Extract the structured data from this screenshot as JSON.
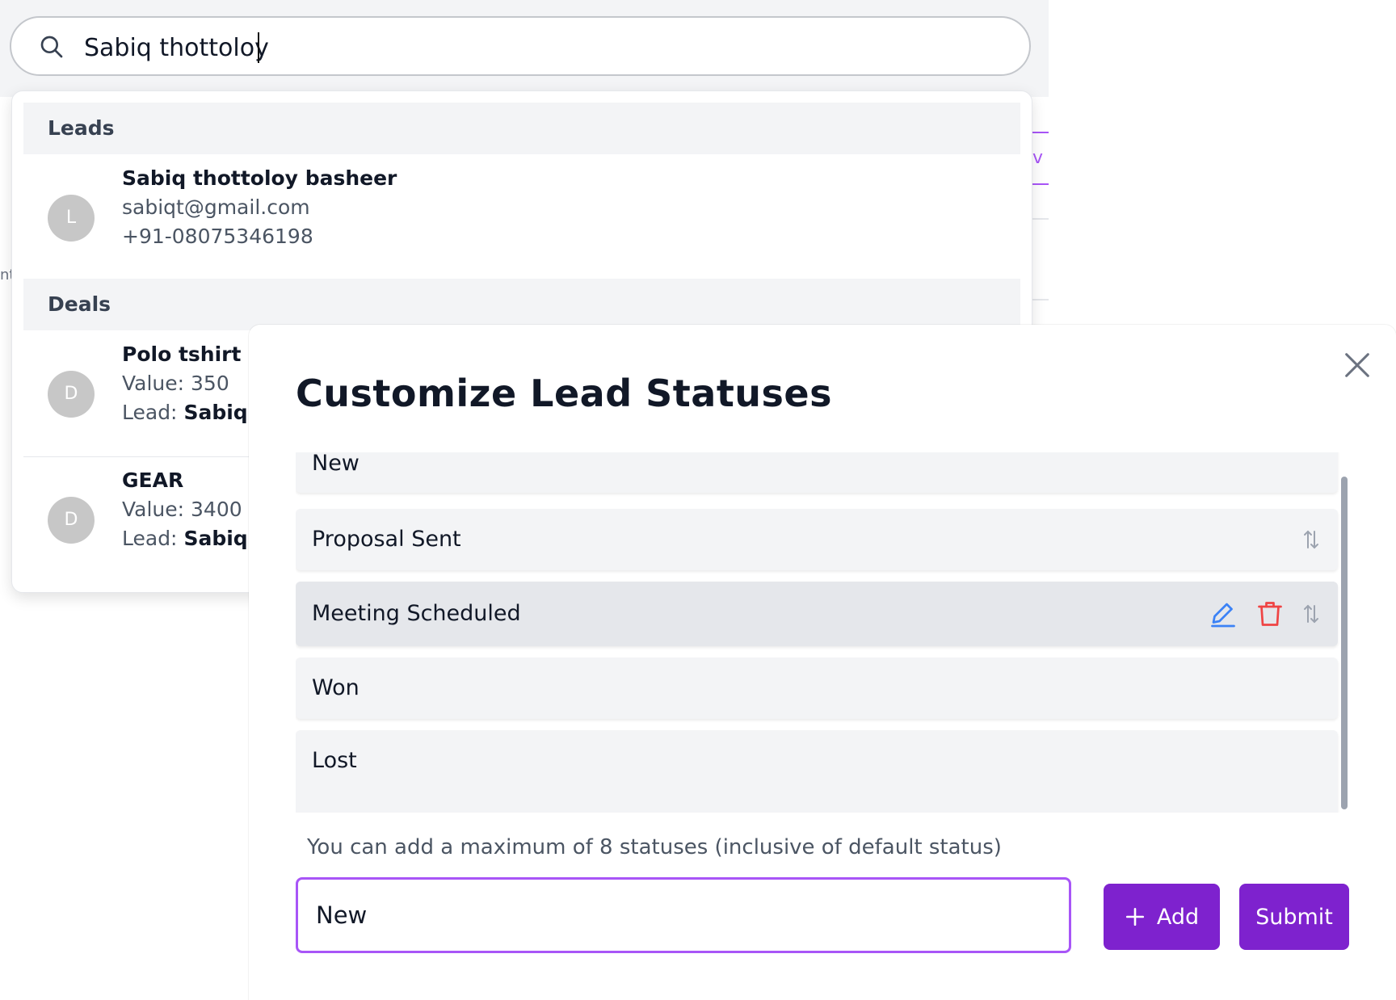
{
  "search": {
    "value": "Sabiq thottoloy",
    "placeholder": ""
  },
  "background": {
    "tab_fragment": "v l",
    "edge_text": "nt"
  },
  "dropdown": {
    "leads_header": "Leads",
    "lead": {
      "avatar": "L",
      "name_match": "Sabiq thottoloy",
      "name_rest": " basheer",
      "email": "sabiqt@gmail.com",
      "phone": "+91-08075346198"
    },
    "deals_header": "Deals",
    "deals": [
      {
        "avatar": "D",
        "title": "Polo tshirt",
        "value": "Value: 350",
        "lead_label": "Lead: ",
        "lead_name": "Sabiq th"
      },
      {
        "avatar": "D",
        "title": "GEAR",
        "value": "Value: 3400",
        "lead_label": "Lead: ",
        "lead_name": "Sabiq th"
      }
    ]
  },
  "modal": {
    "title": "Customize Lead Statuses",
    "statuses": [
      "New",
      "Proposal Sent",
      "Meeting Scheduled",
      "Won",
      "Lost"
    ],
    "hint": "You can add a maximum of 8 statuses (inclusive of default status)",
    "input_value": "New",
    "add_label": "Add",
    "submit_label": "Submit",
    "icons": {
      "close": "close-icon",
      "edit": "pencil-icon",
      "delete": "trash-icon",
      "reorder": "reorder-icon",
      "add": "plus-icon"
    },
    "colors": {
      "accent": "#7e22ce",
      "focus_border": "#a855f7",
      "edit_icon": "#3b82f6",
      "delete_icon": "#ef4444"
    }
  }
}
